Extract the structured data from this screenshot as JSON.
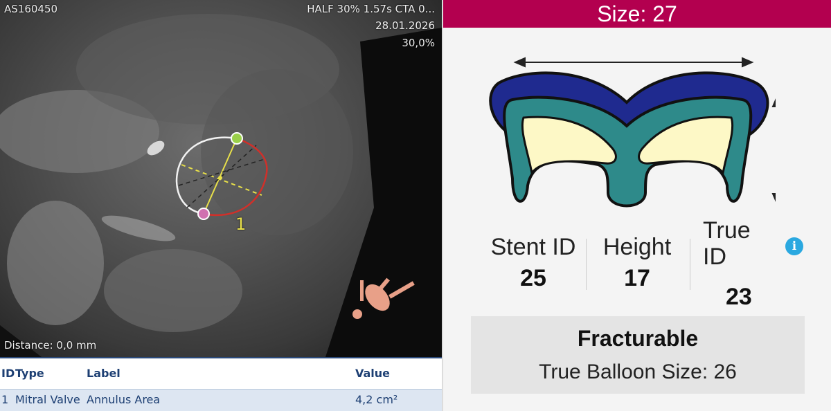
{
  "ct_view": {
    "study_id": "AS160450",
    "series_info": "HALF 30% 1.57s CTA 0...",
    "date": "28.01.2026",
    "phase": "30,0%",
    "distance": "Distance: 0,0 mm",
    "measurement_label": "1"
  },
  "measurement_table": {
    "headers": {
      "id": "ID",
      "type": "Type",
      "label": "Label",
      "value": "Value"
    },
    "rows": [
      {
        "id": "1",
        "type": "Mitral Valve",
        "label": "Annulus Area",
        "value": "4,2 cm²"
      }
    ]
  },
  "valve_panel": {
    "size_title": "Size: 27",
    "stent_id_label": "Stent ID",
    "stent_id_value": "25",
    "height_label": "Height",
    "height_value": "17",
    "true_id_label": "True ID",
    "true_id_value": "23",
    "info_icon": "i",
    "fracturable_title": "Fracturable",
    "balloon_size": "True Balloon Size: 26"
  },
  "colors": {
    "header_accent": "#b3004f",
    "stent_outer": "#1f2a8f",
    "stent_frame": "#2e8a8a",
    "stent_inner": "#fdf8c6",
    "info_blue": "#2aa8e0",
    "table_text": "#1d3f73"
  }
}
